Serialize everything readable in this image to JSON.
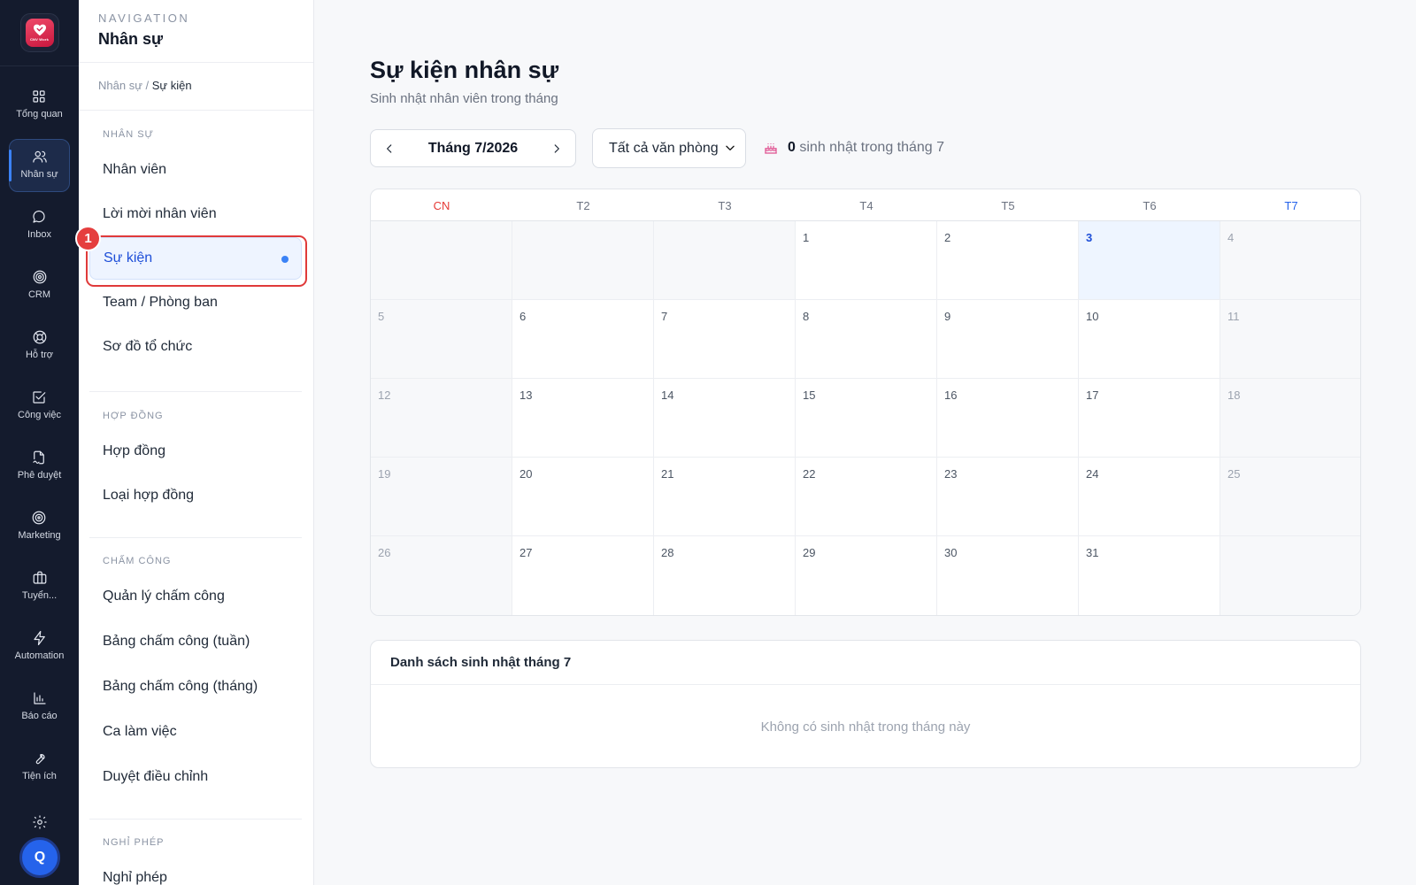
{
  "app": {
    "logo_text": "CNV Work"
  },
  "rail": {
    "items": [
      {
        "label": "Tổng quan",
        "icon": "grid-icon"
      },
      {
        "label": "Nhân sự",
        "icon": "users-icon",
        "active": true
      },
      {
        "label": "Inbox",
        "icon": "chat-icon"
      },
      {
        "label": "CRM",
        "icon": "target-icon"
      },
      {
        "label": "Hỗ trợ",
        "icon": "lifebuoy-icon"
      },
      {
        "label": "Công việc",
        "icon": "checkbox-icon"
      },
      {
        "label": "Phê duyệt",
        "icon": "file-sign-icon"
      },
      {
        "label": "Marketing",
        "icon": "bullseye-icon"
      },
      {
        "label": "Tuyển...",
        "icon": "briefcase-icon"
      },
      {
        "label": "Automation",
        "icon": "bolt-icon"
      },
      {
        "label": "Báo cáo",
        "icon": "bar-chart-icon"
      },
      {
        "label": "Tiện ích",
        "icon": "wrench-icon"
      }
    ],
    "avatar_initial": "Q"
  },
  "nav": {
    "eyebrow": "NAVIGATION",
    "title": "Nhân sự",
    "breadcrumb": {
      "parent": "Nhân sự /",
      "current": "Sự kiện"
    },
    "sections": {
      "nhan_su": "NHÂN SỰ",
      "hop_dong": "HỢP ĐỒNG",
      "cham_cong": "CHẤM CÔNG",
      "nghi_phep": "NGHỈ PHÉP"
    },
    "items": {
      "nhan_vien": "Nhân viên",
      "loi_moi": "Lời mời nhân viên",
      "su_kien": "Sự kiện",
      "team": "Team / Phòng ban",
      "so_do": "Sơ đồ tổ chức",
      "hop_dong": "Hợp đồng",
      "loai_hop_dong": "Loại hợp đồng",
      "quan_ly_cham_cong": "Quản lý chấm công",
      "bang_tuan": "Bảng chấm công (tuần)",
      "bang_thang": "Bảng chấm công (tháng)",
      "ca_lam_viec": "Ca làm việc",
      "duyet_dieu_chinh": "Duyệt điều chỉnh",
      "nghi_phep": "Nghỉ phép"
    },
    "highlight_badge": "1"
  },
  "main": {
    "title": "Sự kiện nhân sự",
    "subtitle": "Sinh nhật nhân viên trong tháng",
    "month_label": "Tháng 7/2026",
    "office_filter": "Tất cả văn phòng",
    "birthday_count": "0",
    "birthday_count_text": "sinh nhật trong tháng 7",
    "weekdays": [
      "CN",
      "T2",
      "T3",
      "T4",
      "T5",
      "T6",
      "T7"
    ],
    "weekday_colors": {
      "sunday": "#e53935",
      "saturday": "#2563eb"
    },
    "today": 3,
    "calendar_rows": [
      [
        "",
        "",
        "",
        "1",
        "2",
        "3",
        "4"
      ],
      [
        "5",
        "6",
        "7",
        "8",
        "9",
        "10",
        "11"
      ],
      [
        "12",
        "13",
        "14",
        "15",
        "16",
        "17",
        "18"
      ],
      [
        "19",
        "20",
        "21",
        "22",
        "23",
        "24",
        "25"
      ],
      [
        "26",
        "27",
        "28",
        "29",
        "30",
        "31",
        ""
      ]
    ],
    "birthday_list_title": "Danh sách sinh nhật tháng 7",
    "birthday_list_empty": "Không có sinh nhật trong tháng này"
  }
}
